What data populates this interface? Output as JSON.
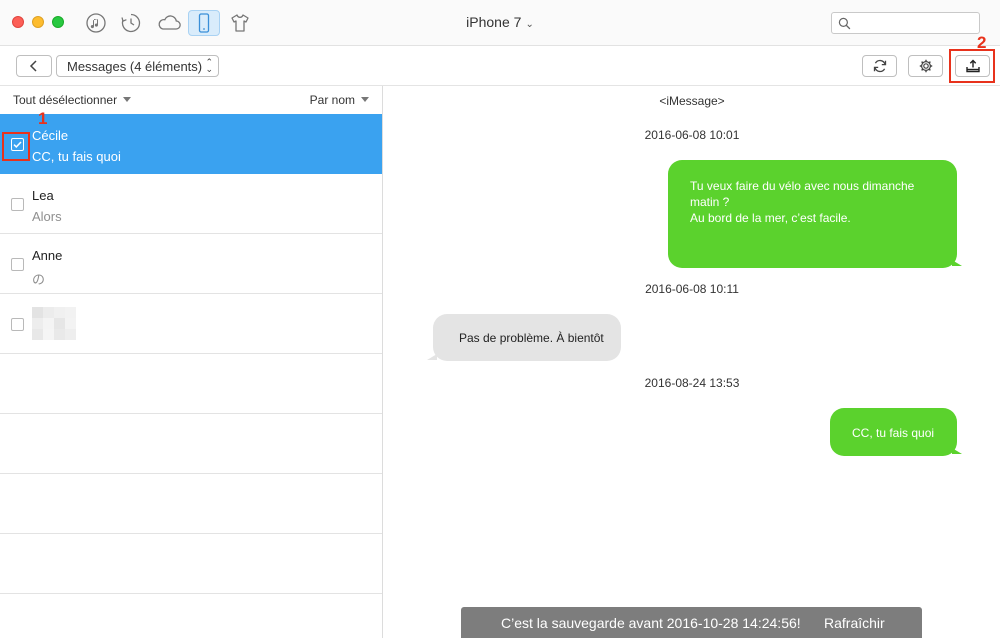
{
  "titlebar": {
    "device_name": "iPhone 7",
    "search": {
      "value": "",
      "placeholder": ""
    },
    "nav_icons": [
      "music-icon",
      "restore-icon",
      "cloud-icon",
      "phone-icon",
      "tshirt-icon"
    ]
  },
  "toolbar": {
    "category_select": "Messages (4 éléments)",
    "step1": "1",
    "step2": "2"
  },
  "list": {
    "deselect_all": "Tout désélectionner",
    "sort_by": "Par nom",
    "items": [
      {
        "name": "Cécile",
        "preview": "CC, tu fais quoi",
        "selected": true
      },
      {
        "name": "Lea",
        "preview": "Alors",
        "selected": false
      },
      {
        "name": "Anne",
        "preview": "の",
        "selected": false
      },
      {
        "name": "",
        "preview": "",
        "selected": false
      }
    ]
  },
  "conversation": {
    "service": "<iMessage>",
    "messages": [
      {
        "timestamp": "2016-06-08 10:01",
        "direction": "outgoing",
        "lines": [
          "Tu veux faire du vélo avec nous dimanche",
          "matin ?",
          "Au bord de la mer, c’est facile."
        ]
      },
      {
        "timestamp": "2016-06-08 10:11",
        "direction": "incoming",
        "lines": [
          "Pas de problème. À bientôt"
        ]
      },
      {
        "timestamp": "2016-08-24 13:53",
        "direction": "outgoing",
        "lines": [
          "CC, tu fais quoi"
        ]
      }
    ]
  },
  "banner": {
    "message": "C’est la sauvegarde avant 2016-10-28 14:24:56!",
    "refresh_link": "Rafraîchir"
  },
  "colors": {
    "selection_blue": "#3aa2f0",
    "outgoing_bubble": "#5bd22d",
    "incoming_bubble": "#e4e4e4",
    "highlight_red": "#e8321c",
    "banner_gray": "#7d7d7d"
  }
}
